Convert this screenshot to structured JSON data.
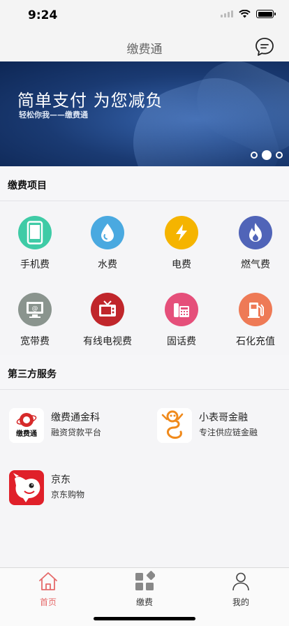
{
  "status_bar": {
    "time": "9:24"
  },
  "nav": {
    "title": "缴费通"
  },
  "banner": {
    "title": "简单支付 为您减负",
    "subtitle": "轻松你我——缴费通"
  },
  "section_payment": {
    "title": "缴费项目"
  },
  "payment_items": [
    {
      "label": "手机费",
      "icon": "phone-icon",
      "color": "#3fcba6"
    },
    {
      "label": "水费",
      "icon": "water-drop-icon",
      "color": "#4aa9e0"
    },
    {
      "label": "电费",
      "icon": "lightning-icon",
      "color": "#f5b400"
    },
    {
      "label": "燃气费",
      "icon": "flame-icon",
      "color": "#5064b8"
    },
    {
      "label": "宽带费",
      "icon": "monitor-icon",
      "color": "#8a948e"
    },
    {
      "label": "有线电视费",
      "icon": "tv-icon",
      "color": "#c0262b"
    },
    {
      "label": "固话费",
      "icon": "telephone-icon",
      "color": "#e54f7a"
    },
    {
      "label": "石化充值",
      "icon": "fuel-pump-icon",
      "color": "#ee7a56"
    }
  ],
  "section_services": {
    "title": "第三方服务"
  },
  "services": [
    {
      "name": "缴费通金科",
      "desc": "融资贷款平台",
      "icon": "jiaofeitong-logo"
    },
    {
      "name": "小表哥金融",
      "desc": "专注供应链金融",
      "icon": "xiaobiaoge-logo"
    },
    {
      "name": "京东",
      "desc": "京东购物",
      "icon": "jd-logo"
    }
  ],
  "tabs": [
    {
      "label": "首页",
      "icon": "home-icon",
      "active": true
    },
    {
      "label": "缴费",
      "icon": "grid-icon",
      "active": false
    },
    {
      "label": "我的",
      "icon": "user-icon",
      "active": false
    }
  ],
  "colors": {
    "accent": "#e56a6a",
    "banner": "#1a3a72"
  }
}
